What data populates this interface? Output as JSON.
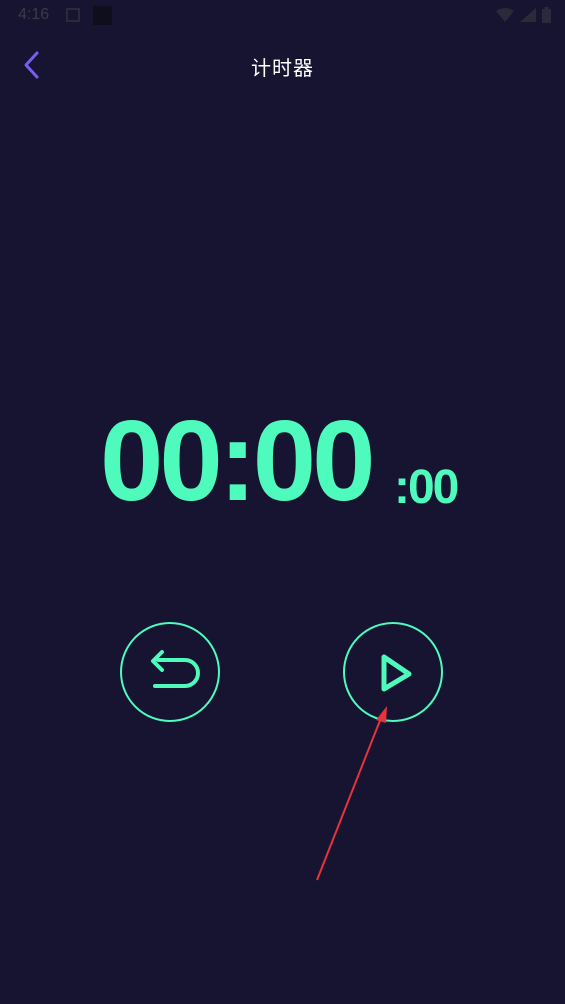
{
  "status_bar": {
    "time": "4:16"
  },
  "header": {
    "title": "计时器"
  },
  "timer": {
    "main": "00:00",
    "sub": ":00"
  },
  "colors": {
    "background": "#161431",
    "accent": "#4efbbd",
    "back_icon": "#7b5cf0",
    "annotation": "#e8323c"
  },
  "icons": {
    "back": "chevron-left-icon",
    "reset": "undo-icon",
    "play": "play-icon"
  }
}
